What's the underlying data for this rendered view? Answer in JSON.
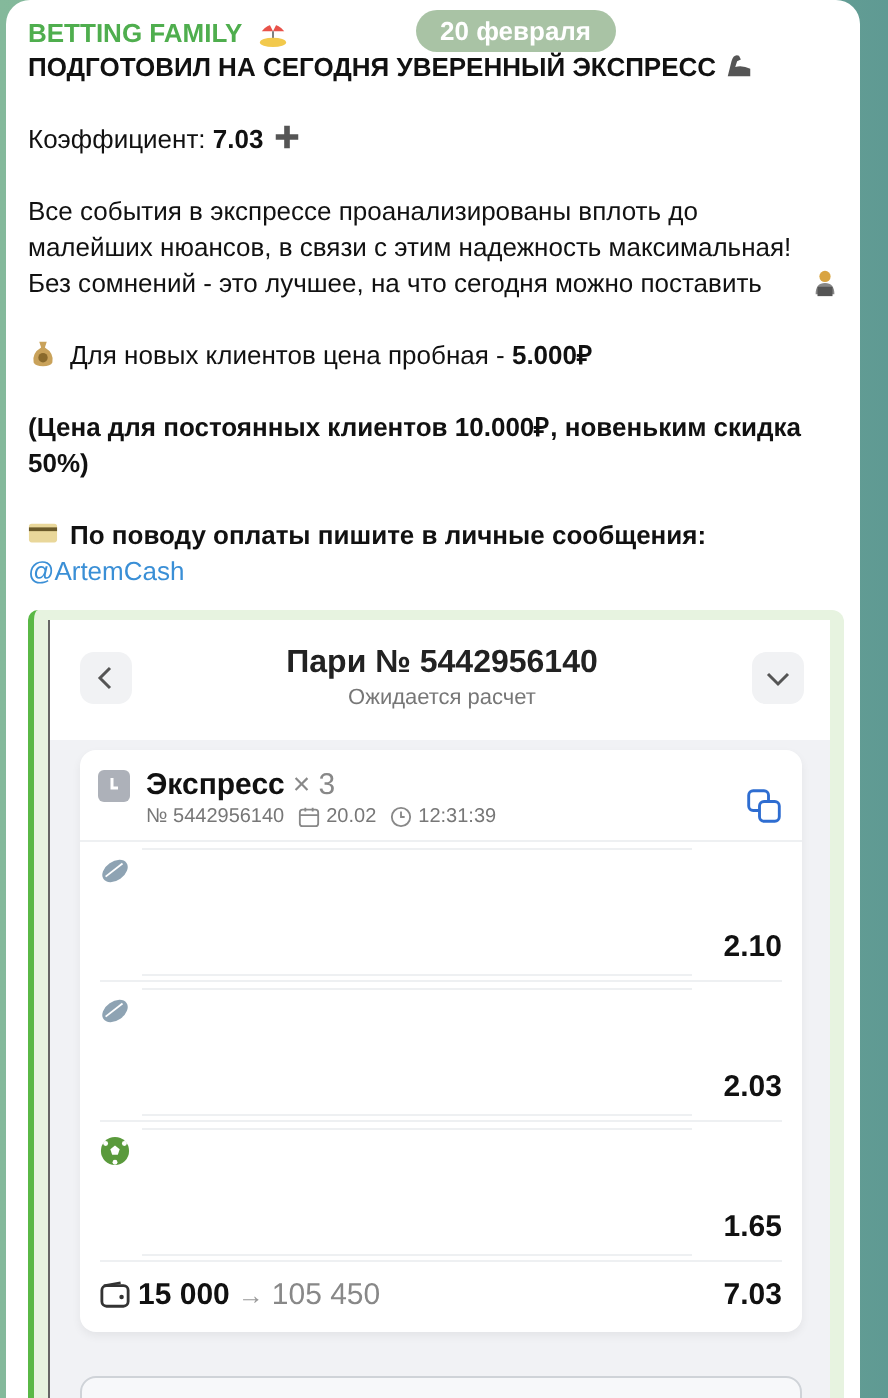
{
  "channel": {
    "name": "BETTING FAMILY"
  },
  "date_pill": "20 февраля",
  "title": "ПОДГОТОВИЛ НА СЕГОДНЯ УВЕРЕННЫЙ ЭКСПРЕСС",
  "paragraphs": [
    {
      "kind": "odds",
      "text": "Коэффициент: **7.03**"
    },
    {
      "kind": "analysis",
      "text": "Все события в экспрессе проанализированы вплоть до малейших нюансов, в связи с этим надежность максимальная! Без сомнений - это лучшее, на что сегодня можно поставить"
    },
    {
      "kind": "price",
      "text": "Для новых клиентов цена пробная - **5.000₽**"
    },
    {
      "kind": "note",
      "text": "(Цена для постоянных клиентов 10.000₽, новеньким скидка 50%)"
    },
    {
      "kind": "contact",
      "text": "По поводу оплаты пишите в личные сообщения:",
      "link": "@ArtemCash"
    }
  ],
  "bet": {
    "title": "Пари № 5442956140",
    "status": "Ожидается расчет",
    "type": "Экспресс",
    "count": "× 3",
    "number": "№ 5442956140",
    "date": "20.02",
    "time": "12:31:39",
    "events": [
      {
        "kind": "hockey",
        "odds": "2.10"
      },
      {
        "kind": "hockey",
        "odds": "2.03"
      },
      {
        "kind": "football",
        "odds": "1.65"
      }
    ],
    "stake": "15 000",
    "arrow": "→",
    "payout": "105 450",
    "total_odds": "7.03"
  }
}
